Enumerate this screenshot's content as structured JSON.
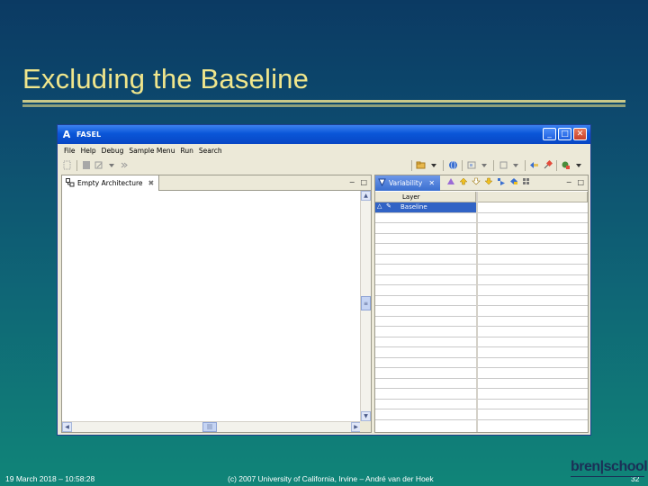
{
  "slide": {
    "title": "Excluding the Baseline",
    "footer_left": "19 March 2018 – 10:58:28",
    "footer_center": "(c) 2007 University of California, Irvine – André van der Hoek",
    "page_number": "32",
    "logo_word": "bren",
    "logo_word2": "school"
  },
  "window": {
    "title": "FASEL",
    "app_icon": "A",
    "buttons": {
      "minimize": "_",
      "maximize": "□",
      "close": "✕"
    }
  },
  "menubar": {
    "items": [
      "File",
      "Help",
      "Debug",
      "Sample Menu",
      "Run",
      "Search"
    ]
  },
  "editor": {
    "tab_label": "Empty Architecture",
    "tab_close": "✖",
    "min": "−",
    "max": "□"
  },
  "variability": {
    "tab_label": "Variability",
    "tab_close": "✕",
    "column_header": "Layer",
    "rows": [
      {
        "label": "Baseline",
        "selected": true
      }
    ],
    "min": "−",
    "max": "□"
  }
}
